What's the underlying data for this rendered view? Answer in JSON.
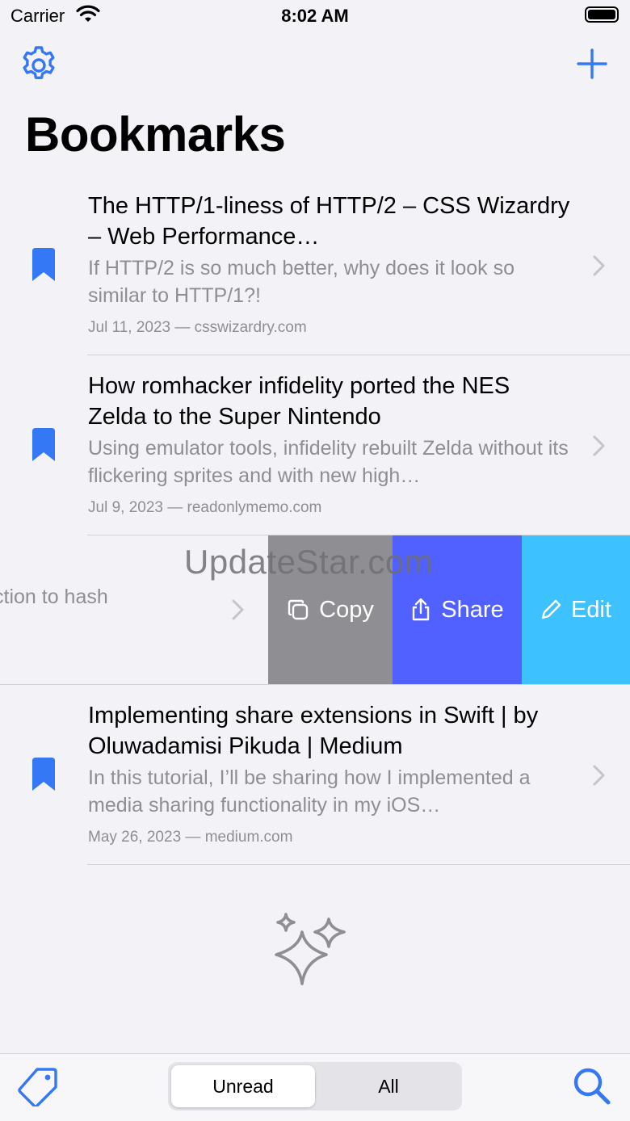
{
  "status_bar": {
    "carrier": "Carrier",
    "time": "8:02 AM"
  },
  "nav": {
    "settings_icon": "gear-icon",
    "add_icon": "plus-icon"
  },
  "page": {
    "title": "Bookmarks"
  },
  "bookmarks": [
    {
      "title": "The HTTP/1-liness of HTTP/2 – CSS Wizardry – Web Performance…",
      "description": "If HTTP/2 is so much better, why does it look so similar to HTTP/1?!",
      "meta": "Jul 11, 2023 — csswizardry.com"
    },
    {
      "title": "How romhacker infidelity ported the NES Zelda to the Super Nintendo",
      "description": "Using emulator tools, infidelity rebuilt Zelda without its flickering sprites and with new high…",
      "meta": "Jul 9, 2023 — readonlymemo.com"
    },
    {
      "title": "Implementing share extensions in Swift | by Oluwadamisi Pikuda | Medium",
      "description": "In this tutorial, I’ll be sharing how I implemented a media sharing functionality in my iOS…",
      "meta": "May 26, 2023 — medium.com"
    }
  ],
  "swiped_row": {
    "partial_text": "ction to hash",
    "actions": {
      "copy": "Copy",
      "share": "Share",
      "edit": "Edit"
    }
  },
  "watermark": "UpdateStar.com",
  "tab_bar": {
    "segments": {
      "unread": "Unread",
      "all": "All"
    },
    "selected": "Unread"
  },
  "colors": {
    "accent": "#3478f6",
    "copy_action": "#8e8e93",
    "share_action": "#5061ff",
    "edit_action": "#3ec2ff"
  }
}
